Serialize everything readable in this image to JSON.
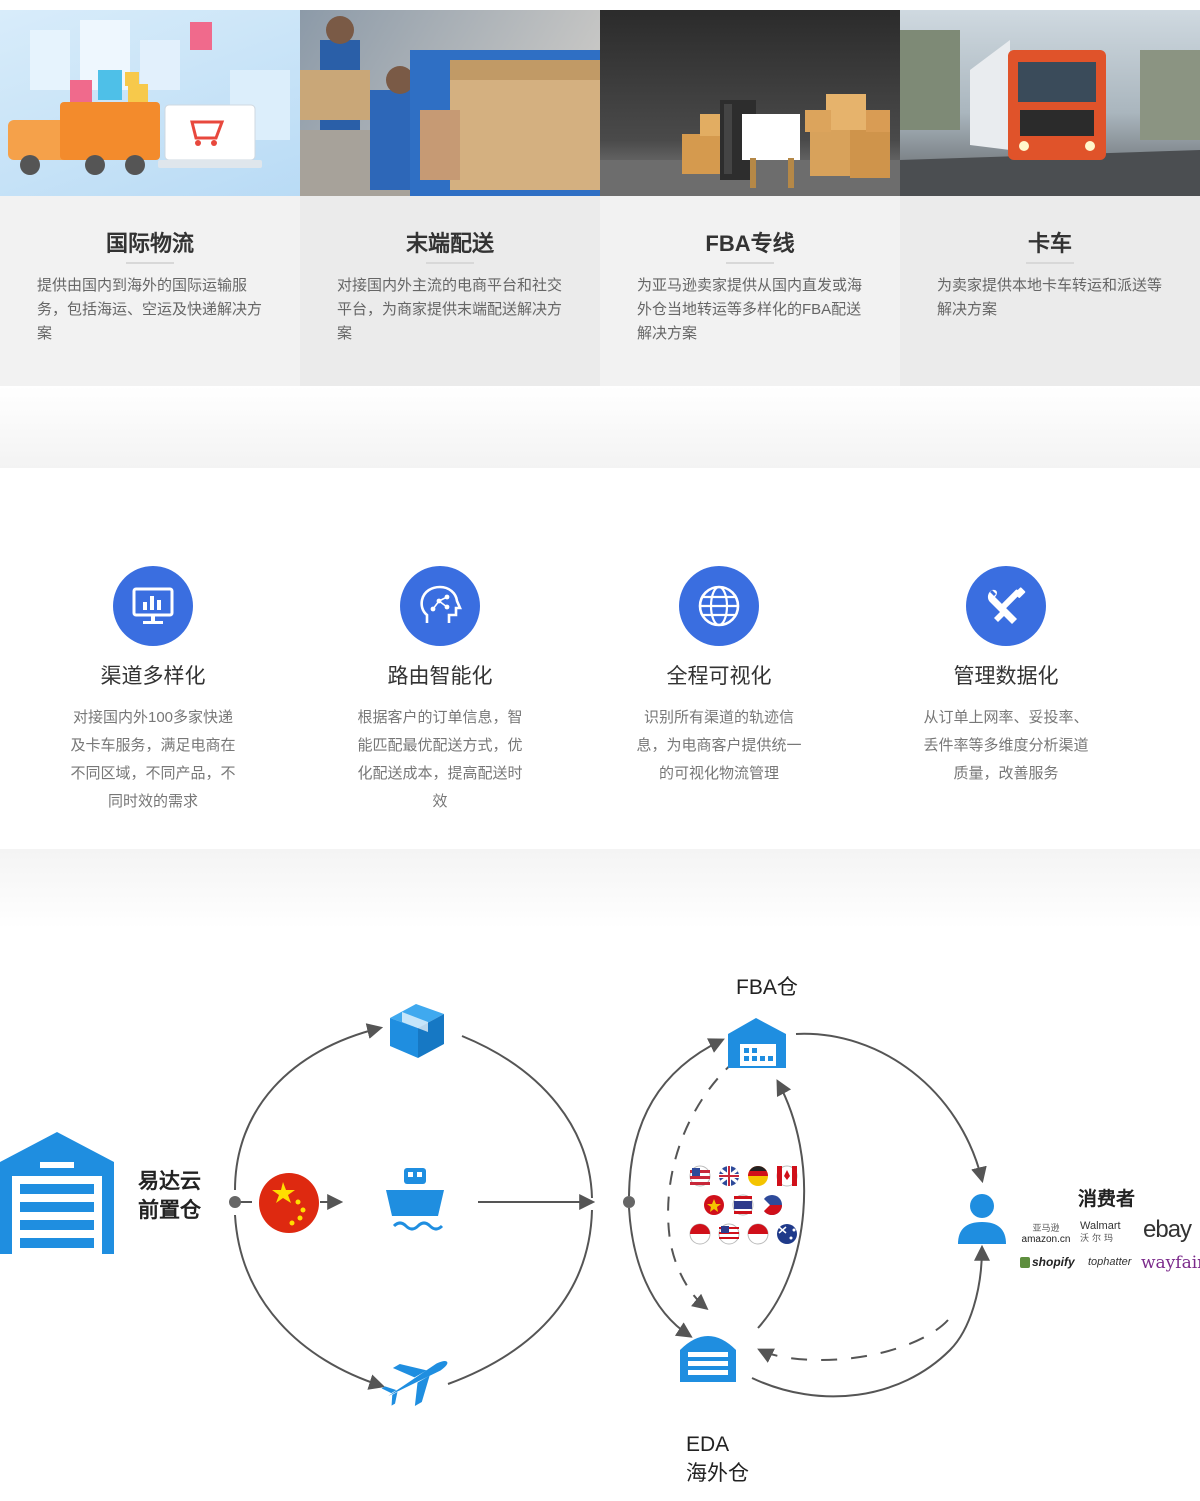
{
  "services": [
    {
      "title": "国际物流",
      "desc": "提供由国内到海外的国际运输服务，包括海运、空运及快递解决方案"
    },
    {
      "title": "末端配送",
      "desc": "对接国内外主流的电商平台和社交平台，为商家提供末端配送解决方案"
    },
    {
      "title": "FBA专线",
      "desc": "为亚马逊卖家提供从国内直发或海外仓当地转运等多样化的FBA配送解决方案"
    },
    {
      "title": "卡车",
      "desc": "为卖家提供本地卡车转运和派送等解决方案"
    }
  ],
  "features": [
    {
      "icon": "chart-monitor-icon",
      "title": "渠道多样化",
      "desc": "对接国内外100多家快递及卡车服务，满足电商在不同区域，不同产品，不同时效的需求"
    },
    {
      "icon": "ai-head-icon",
      "title": "路由智能化",
      "desc": "根据客户的订单信息，智能匹配最优配送方式，优化配送成本，提高配送时效"
    },
    {
      "icon": "globe-icon",
      "title": "全程可视化",
      "desc": "识别所有渠道的轨迹信息，为电商客户提供统一的可视化物流管理"
    },
    {
      "icon": "wrench-screwdriver-icon",
      "title": "管理数据化",
      "desc": "从订单上网率、妥投率、丢件率等多维度分析渠道质量，改善服务"
    }
  ],
  "diagram": {
    "origin_line1": "易达云",
    "origin_line2": "前置仓",
    "fba_label": "FBA仓",
    "eda_line1": "EDA",
    "eda_line2": "海外仓",
    "consumer_label": "消费者",
    "platforms": {
      "amazon_cn": "亚马逊",
      "amazon": "amazon.cn",
      "walmart": "Walmart",
      "walmart_cn": "沃尔玛",
      "ebay": "ebay",
      "shopify": "shopify",
      "tophatter": "tophatter",
      "wayfair": "wayfair"
    },
    "flags": [
      "us",
      "uk",
      "de",
      "ca",
      "vn",
      "th",
      "ph",
      "sg",
      "my",
      "id",
      "au"
    ],
    "colors": {
      "accent_blue": "#1f8ee0",
      "feature_blue": "#3a6ee0",
      "china_red": "#de2910"
    }
  }
}
